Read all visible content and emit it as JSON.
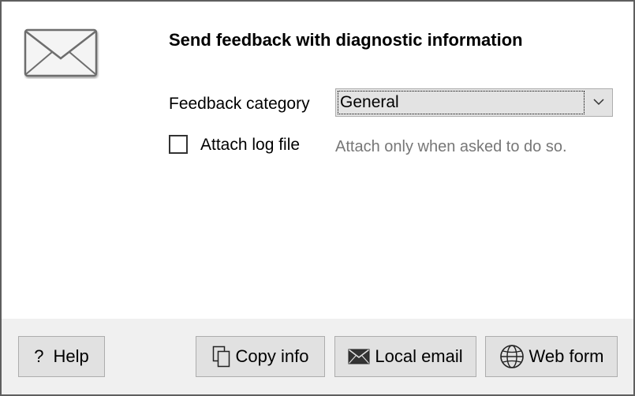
{
  "dialog": {
    "title": "Send feedback with diagnostic information",
    "feedback_category_label": "Feedback category",
    "feedback_category_value": "General",
    "attach_log_label": "Attach log file",
    "attach_log_checked": false,
    "attach_log_hint": "Attach only when asked to do so."
  },
  "buttons": {
    "help_glyph": "?",
    "help": "Help",
    "copy_info": "Copy info",
    "local_email": "Local email",
    "web_form": "Web form"
  },
  "icons": {
    "header": "envelope-icon",
    "dropdown": "chevron-down-icon",
    "copy": "copy-icon",
    "email": "mail-icon",
    "web": "globe-icon"
  },
  "colors": {
    "footer_bg": "#f0f0f0",
    "button_bg": "#e1e1e1",
    "hint_text": "#777777"
  }
}
